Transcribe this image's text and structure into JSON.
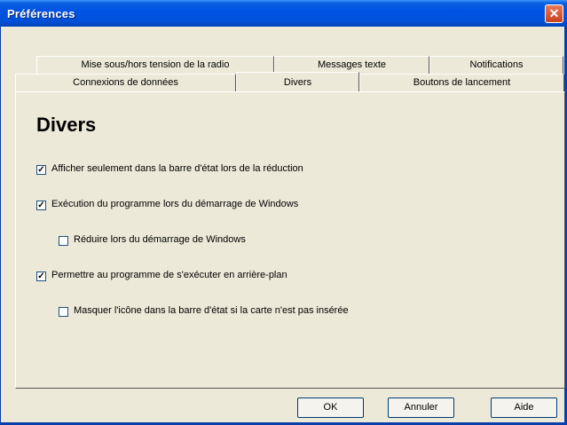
{
  "window": {
    "title": "Préférences",
    "close_glyph": "✕"
  },
  "tabs": {
    "row1": [
      {
        "label": "Mise sous/hors tension de la radio"
      },
      {
        "label": "Messages texte"
      },
      {
        "label": "Notifications"
      }
    ],
    "row2": [
      {
        "label": "Connexions de données"
      },
      {
        "label": "Divers",
        "active": true
      },
      {
        "label": "Boutons de lancement"
      }
    ]
  },
  "panel": {
    "title": "Divers",
    "options": [
      {
        "label": "Afficher seulement dans la barre d'état lors de la réduction",
        "checked": true
      },
      {
        "label": "Exécution du programme lors du démarrage de Windows",
        "checked": true
      },
      {
        "label": "Réduire lors du démarrage de Windows",
        "checked": false
      },
      {
        "label": "Permettre au programme de s'exécuter en arrière-plan",
        "checked": true
      },
      {
        "label": "Masquer l'icône dans la barre d'état si la carte n'est pas insérée",
        "checked": false
      }
    ],
    "check_glyph": "✓"
  },
  "buttons": {
    "ok": "OK",
    "cancel": "Annuler",
    "help": "Aide"
  }
}
